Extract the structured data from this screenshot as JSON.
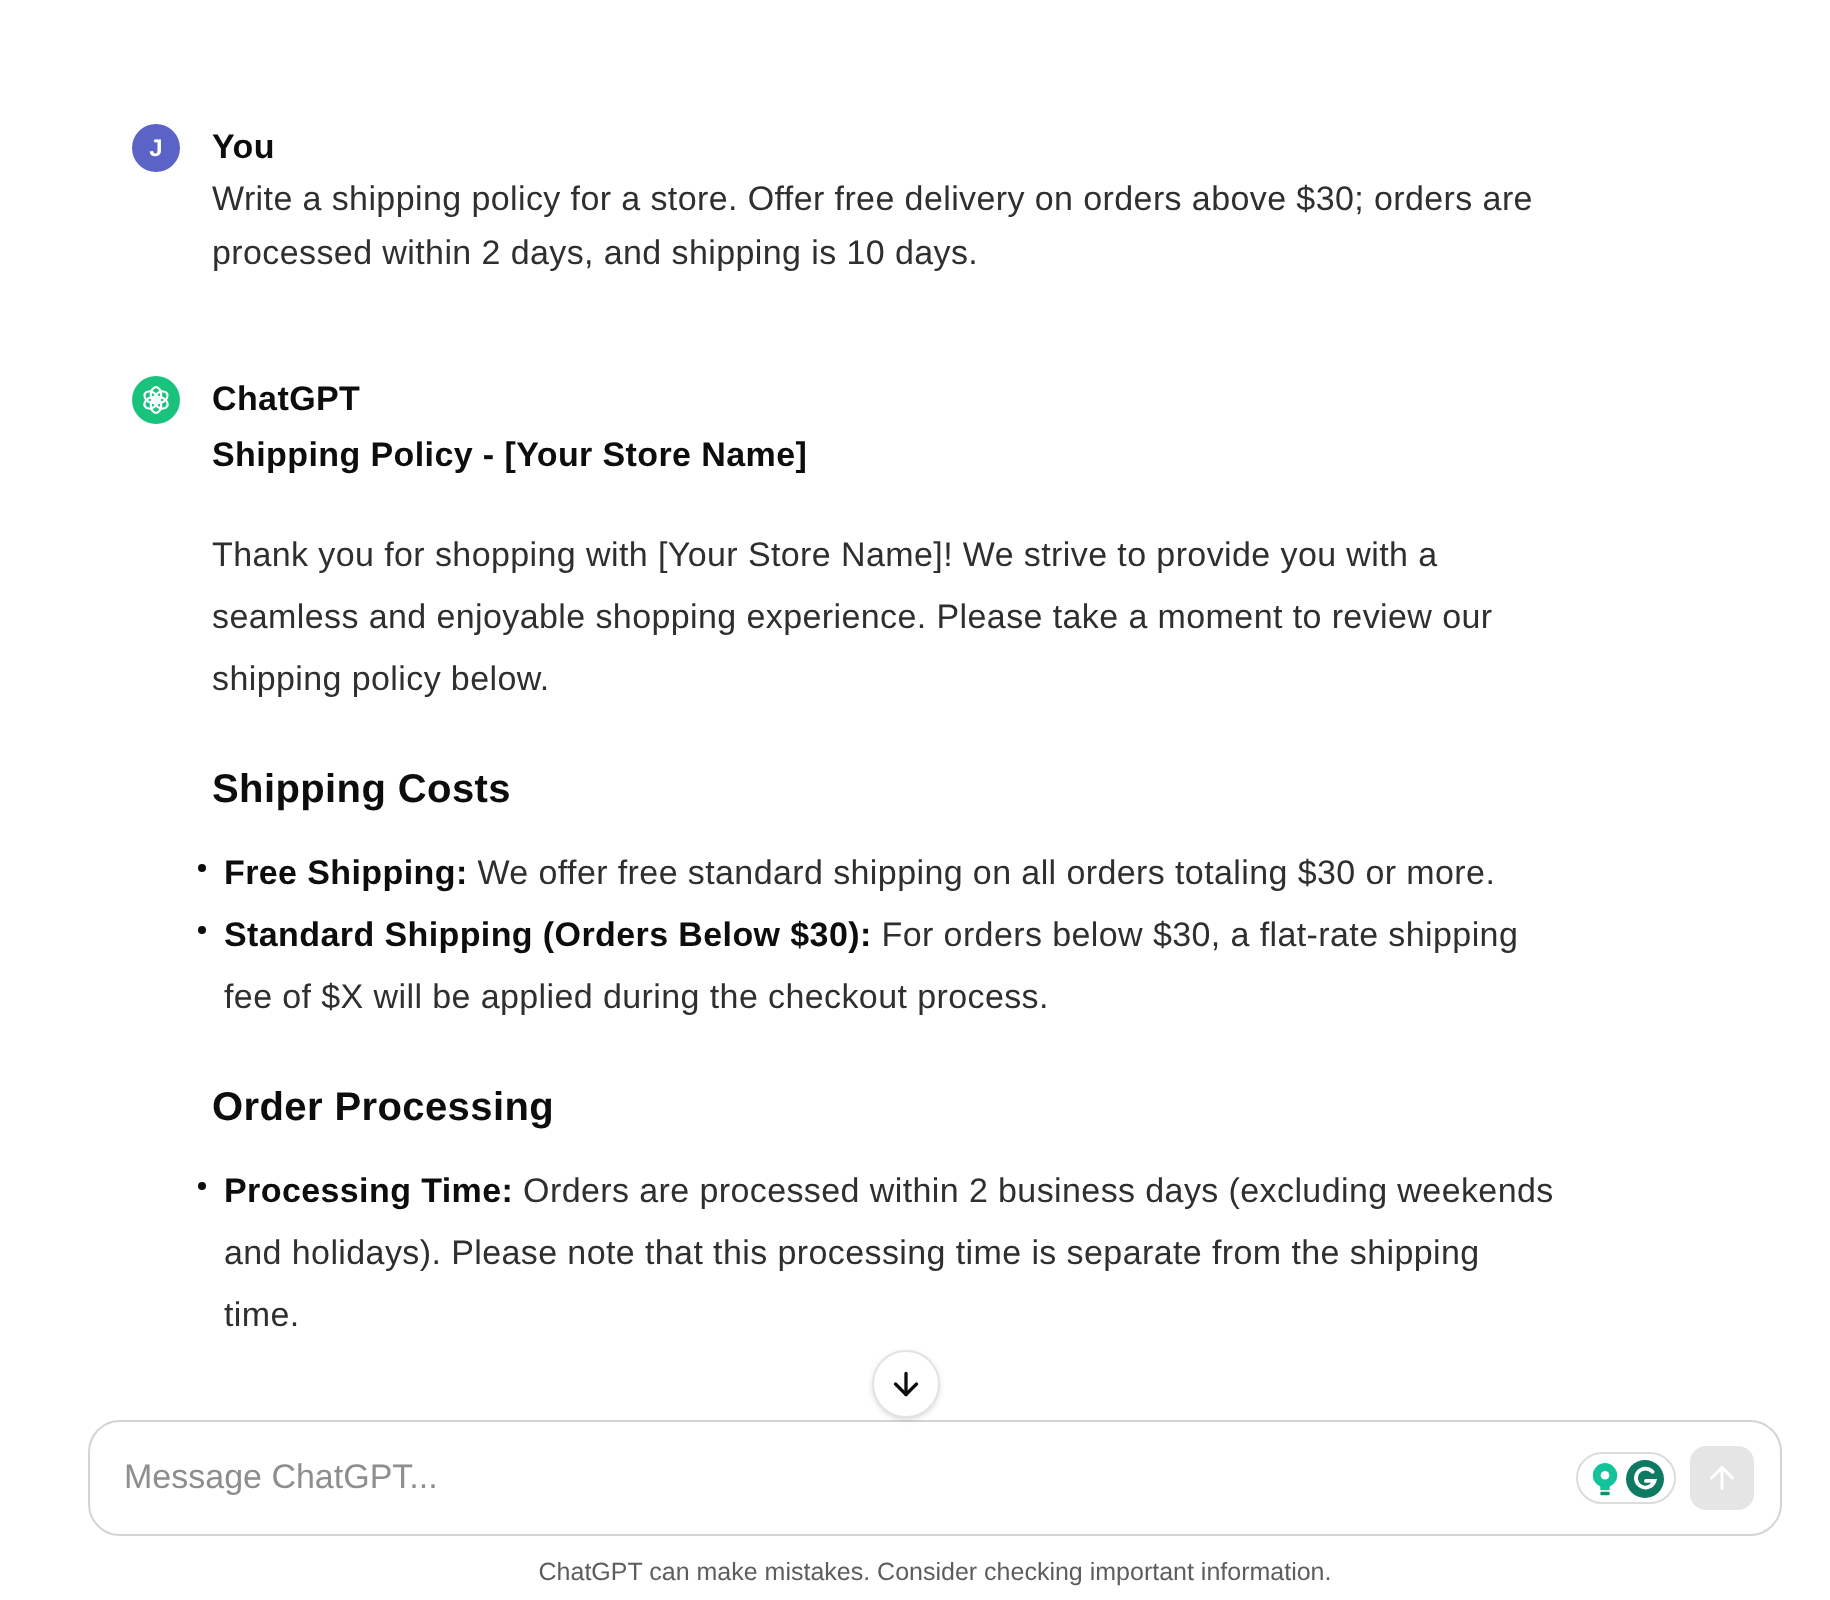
{
  "messages": [
    {
      "kind": "user",
      "author": "You",
      "avatar_letter": "J",
      "text": "Write a shipping policy for a store. Offer free delivery on orders above $30; orders are processed within 2 days, and shipping is 10 days."
    },
    {
      "kind": "assistant",
      "author": "ChatGPT",
      "blocks": [
        {
          "kind": "title",
          "text": "Shipping Policy - [Your Store Name]"
        },
        {
          "kind": "paragraph",
          "text": "Thank you for shopping with [Your Store Name]! We strive to provide you with a seamless and enjoyable shopping experience. Please take a moment to review our shipping policy below."
        },
        {
          "kind": "heading",
          "text": "Shipping Costs"
        },
        {
          "kind": "list",
          "items": [
            "**Free Shipping:** We offer free standard shipping on all orders totaling $30 or more.",
            "**Standard Shipping (Orders Below $30):** For orders below $30, a flat-rate shipping fee of $X will be applied during the checkout process."
          ]
        },
        {
          "kind": "heading",
          "text": "Order Processing"
        },
        {
          "kind": "list",
          "items": [
            "**Processing Time:** Orders are processed within 2 business days (excluding weekends and holidays). Please note that this processing time is separate from the shipping time."
          ]
        }
      ]
    }
  ],
  "composer": {
    "placeholder": "Message ChatGPT...",
    "send_button": {
      "disabled": true
    }
  },
  "footer": "ChatGPT can make mistakes. Consider checking important information."
}
